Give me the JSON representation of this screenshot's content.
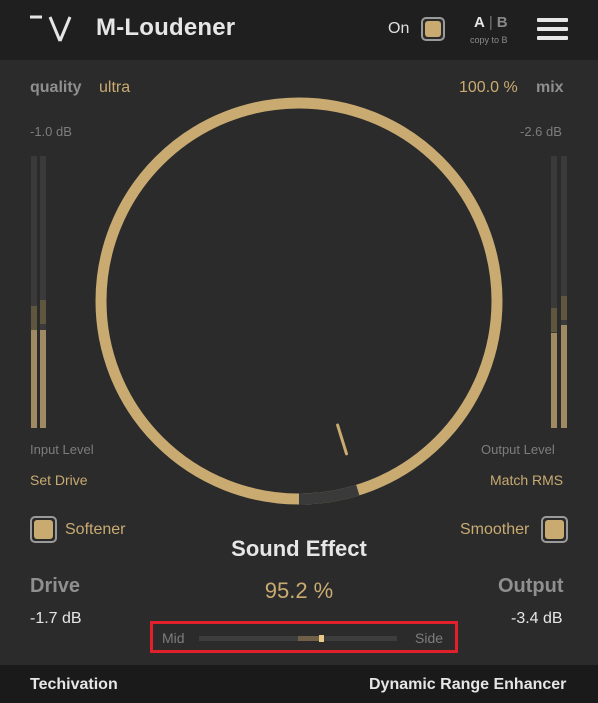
{
  "colors": {
    "accent": "#c9ab72",
    "background": "#2b2b2b",
    "highlight_border": "#e0202a"
  },
  "header": {
    "title": "M-Loudener",
    "on_label": "On",
    "on_state": true,
    "ab_a": "A",
    "ab_sep": "|",
    "ab_b": "B",
    "copy_label": "copy to B",
    "menu_icon": "hamburger-menu-icon",
    "logo_icon": "techivation-logo-icon"
  },
  "quality": {
    "label": "quality",
    "value": "ultra"
  },
  "mix": {
    "value": "100.0 %",
    "label": "mix"
  },
  "input": {
    "peak": "-1.0 dB",
    "label": "Input Level",
    "action": "Set Drive",
    "meter_levels": [
      0.36,
      0.36
    ]
  },
  "output": {
    "peak": "-2.6 dB",
    "label": "Output Level",
    "action": "Match RMS",
    "meter_levels": [
      0.35,
      0.38
    ]
  },
  "dial": {
    "value_percent": 95.2
  },
  "softener": {
    "label": "Softener",
    "checked": true
  },
  "smoother": {
    "label": "Smoother",
    "checked": true
  },
  "effect": {
    "name": "Sound Effect",
    "value": "95.2 %"
  },
  "drive": {
    "label": "Drive",
    "value": "-1.7 dB"
  },
  "output_gain": {
    "label": "Output",
    "value": "-3.4 dB"
  },
  "mid_side": {
    "mid_label": "Mid",
    "side_label": "Side",
    "position_percent": 62
  },
  "footer": {
    "brand": "Techivation",
    "product": "Dynamic Range Enhancer"
  }
}
